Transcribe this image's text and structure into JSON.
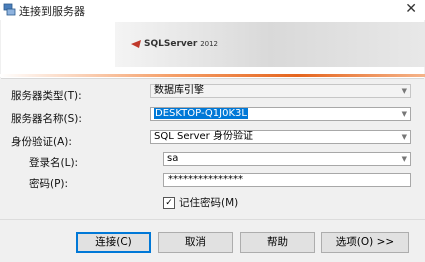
{
  "window": {
    "title": "连接到服务器",
    "close_glyph": "✕"
  },
  "banner": {
    "product_name": "SQLServer",
    "product_version": "2012"
  },
  "form": {
    "server_type": {
      "label": "服务器类型(T):",
      "value": "数据库引擎"
    },
    "server_name": {
      "label": "服务器名称(S):",
      "value": "DESKTOP-Q1J0K3L"
    },
    "authentication": {
      "label": "身份验证(A):",
      "value": "SQL Server 身份验证"
    },
    "login": {
      "label": "登录名(L):",
      "value": "sa"
    },
    "password": {
      "label": "密码(P):",
      "value": "***************"
    },
    "remember_password": {
      "label": "记住密码(M)",
      "checked": true
    }
  },
  "buttons": {
    "connect": "连接(C)",
    "cancel": "取消",
    "help": "帮助",
    "options": "选项(O) >>"
  },
  "colors": {
    "accent": "#0078d7",
    "orange": "#e5651e"
  }
}
